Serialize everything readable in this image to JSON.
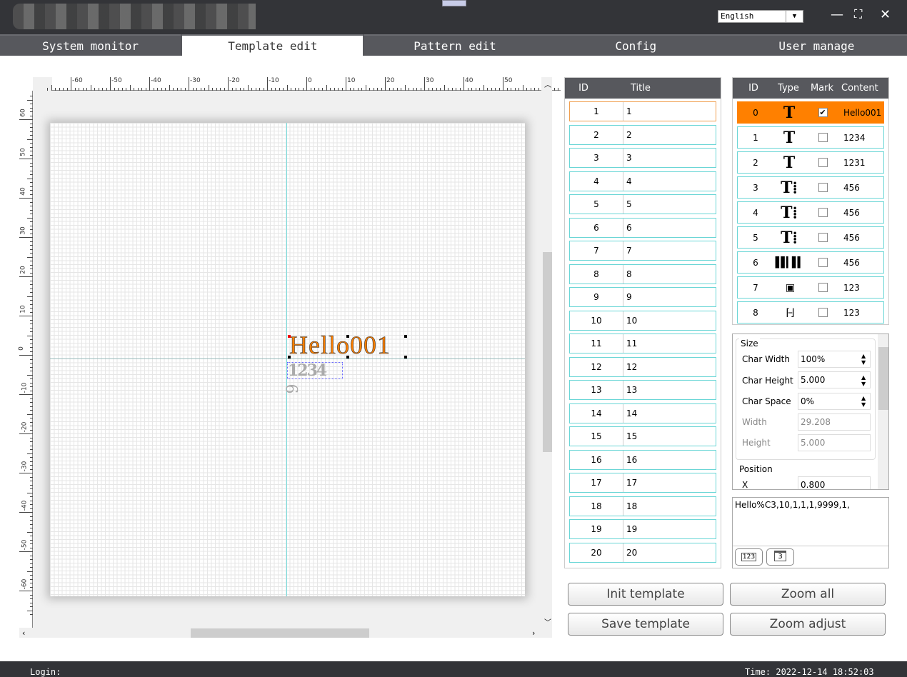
{
  "window": {
    "language": "English",
    "minimize": "—",
    "maximize": "⛶",
    "close": "✕"
  },
  "tabs": [
    {
      "label": "System monitor"
    },
    {
      "label": "Template edit"
    },
    {
      "label": "Pattern edit"
    },
    {
      "label": "Config"
    },
    {
      "label": "User manage"
    }
  ],
  "ruler": {
    "x_ticks": [
      -60,
      -50,
      -40,
      -30,
      -20,
      -10,
      0,
      10,
      20,
      30,
      40,
      50,
      60
    ],
    "y_ticks": [
      60,
      50,
      40,
      30,
      20,
      10,
      0,
      -10,
      -20,
      -30,
      -40,
      -50,
      -60
    ]
  },
  "canvas": {
    "selected_text": "Hello001",
    "overlap_text": "1234",
    "rotated_text": "6",
    "selected_color": "#ff8000"
  },
  "templates": {
    "headers": {
      "id": "ID",
      "title": "Title"
    },
    "rows": [
      [
        "1",
        "1"
      ],
      [
        "2",
        "2"
      ],
      [
        "3",
        "3"
      ],
      [
        "4",
        "4"
      ],
      [
        "5",
        "5"
      ],
      [
        "6",
        "6"
      ],
      [
        "7",
        "7"
      ],
      [
        "8",
        "8"
      ],
      [
        "9",
        "9"
      ],
      [
        "10",
        "10"
      ],
      [
        "11",
        "11"
      ],
      [
        "12",
        "12"
      ],
      [
        "13",
        "13"
      ],
      [
        "14",
        "14"
      ],
      [
        "15",
        "15"
      ],
      [
        "16",
        "16"
      ],
      [
        "17",
        "17"
      ],
      [
        "18",
        "18"
      ],
      [
        "19",
        "19"
      ],
      [
        "20",
        "20"
      ]
    ],
    "selected": 0
  },
  "objects": {
    "headers": {
      "id": "ID",
      "type": "Type",
      "mark": "Mark",
      "content": "Content"
    },
    "rows": [
      {
        "id": "0",
        "type": "text",
        "mark": true,
        "content": "Hello001"
      },
      {
        "id": "1",
        "type": "text",
        "mark": false,
        "content": "1234"
      },
      {
        "id": "2",
        "type": "text",
        "mark": false,
        "content": "1231"
      },
      {
        "id": "3",
        "type": "text-vertical",
        "mark": false,
        "content": "456"
      },
      {
        "id": "4",
        "type": "text-vertical",
        "mark": false,
        "content": "456"
      },
      {
        "id": "5",
        "type": "text-vertical",
        "mark": false,
        "content": "456"
      },
      {
        "id": "6",
        "type": "barcode",
        "mark": false,
        "content": "456"
      },
      {
        "id": "7",
        "type": "qrcode",
        "mark": false,
        "content": "123"
      },
      {
        "id": "8",
        "type": "datamatrix",
        "mark": false,
        "content": "123"
      }
    ],
    "selected": 0
  },
  "props": {
    "size_label": "Size",
    "char_width_label": "Char Width",
    "char_width": "100%",
    "char_height_label": "Char Height",
    "char_height": "5.000",
    "char_space_label": "Char Space",
    "char_space": "0%",
    "width_label": "Width",
    "width": "29.208",
    "height_label": "Height",
    "height": "5.000",
    "position_label": "Position",
    "x_label": "X",
    "x": "0.800"
  },
  "script": {
    "text": "Hello%C3,10,1,1,1,9999,1,",
    "counter_btn": "123",
    "date_btn": "3"
  },
  "buttons": {
    "init": "Init template",
    "zoom_all": "Zoom all",
    "save": "Save template",
    "zoom_adjust": "Zoom adjust"
  },
  "status": {
    "login": "Login:",
    "time": "Time: 2022-12-14 18:52:03"
  }
}
